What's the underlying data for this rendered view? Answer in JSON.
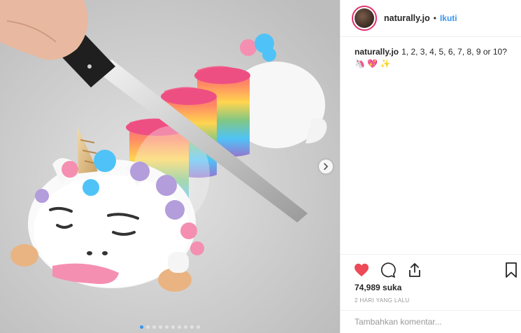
{
  "header": {
    "username": "naturally.jo",
    "separator": "•",
    "follow_label": "Ikuti"
  },
  "caption": {
    "username": "naturally.jo",
    "text": "1, 2, 3, 4, 5, 6, 7, 8, 9 or 10? 🦄 💖 ✨"
  },
  "likes": "74,989 suka",
  "timestamp": "2 HARI YANG LALU",
  "comment": {
    "placeholder": "Tambahkan komentar..."
  },
  "carousel": {
    "total": 10,
    "active_index": 0
  },
  "colors": {
    "like_red": "#ed4956",
    "follow_blue": "#3897f0"
  },
  "icons": {
    "like": "heart-icon",
    "comment": "comment-icon",
    "share": "share-icon",
    "save": "bookmark-icon",
    "next": "chevron-right-icon"
  }
}
